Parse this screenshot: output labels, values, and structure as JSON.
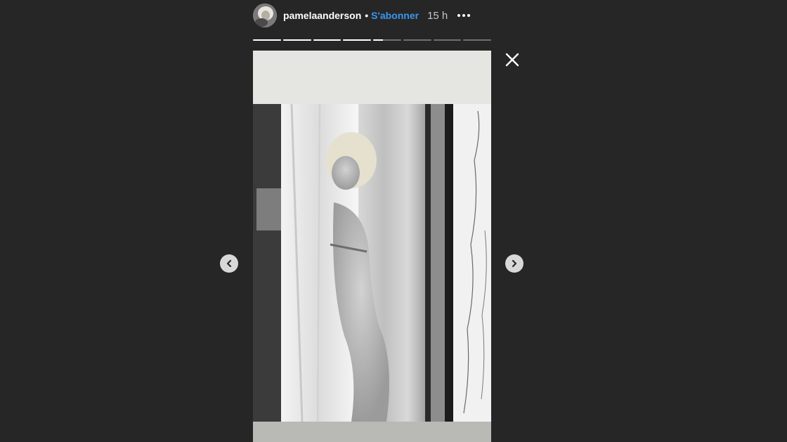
{
  "header": {
    "username": "pamelaanderson",
    "separator": "•",
    "follow_label": "S'abonner",
    "timestamp": "15 h"
  },
  "progress": {
    "segments": [
      1,
      1,
      1,
      1,
      0.35,
      0,
      0,
      0
    ]
  },
  "icons": {
    "avatar": "profile-avatar",
    "more": "more-options-icon",
    "close": "close-icon",
    "prev": "chevron-left-icon",
    "next": "chevron-right-icon"
  },
  "colors": {
    "background": "#262626",
    "follow_link": "#3897f0",
    "progress_active": "#ffffff"
  }
}
